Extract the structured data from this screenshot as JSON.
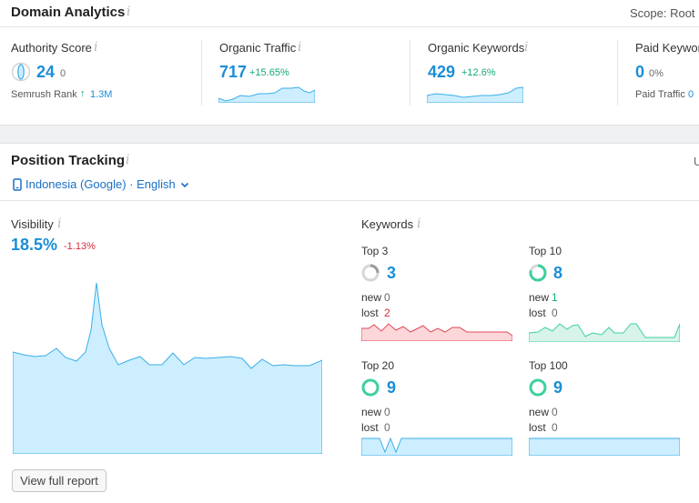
{
  "domain_analytics": {
    "title": "Domain Analytics",
    "info": "i",
    "scope": "Scope: Root D",
    "authority": {
      "label": "Authority Score",
      "value": "24",
      "sub": "0",
      "rank_label": "Semrush Rank",
      "rank_value": "1.3M",
      "rank_arrow": "↑"
    },
    "organic_traffic": {
      "label": "Organic Traffic",
      "value": "717",
      "change": "+15.65%"
    },
    "organic_keywords": {
      "label": "Organic Keywords",
      "value": "429",
      "change": "+12.6%"
    },
    "paid_keywords": {
      "label": "Paid Keywords",
      "value": "0",
      "percent": "0%",
      "paid_traffic_label": "Paid Traffic",
      "paid_traffic_value": "0"
    }
  },
  "position_tracking": {
    "title": "Position Tracking",
    "info": "i",
    "location": "Indonesia (Google) · English",
    "right_edge": "U",
    "visibility": {
      "label": "Visibility",
      "value": "18.5%",
      "change": "-1.13%"
    },
    "keywords": {
      "label": "Keywords",
      "new_label": "new",
      "lost_label": "lost",
      "groups": [
        {
          "name": "Top 3",
          "value": "3",
          "new": "0",
          "lost": "2"
        },
        {
          "name": "Top 10",
          "value": "8",
          "new": "1",
          "lost": "0"
        },
        {
          "name": "Top 20",
          "value": "9",
          "new": "0",
          "lost": "0"
        },
        {
          "name": "Top 100",
          "value": "9",
          "new": "0",
          "lost": "0"
        }
      ]
    },
    "view_full_report": "View full report"
  },
  "colors": {
    "accent_blue": "#1a8ed8",
    "positive_green": "#15a87a",
    "negative_red": "#d62b3a",
    "chart_fill": "#cdeeff",
    "chart_stroke": "#3aaee8"
  }
}
